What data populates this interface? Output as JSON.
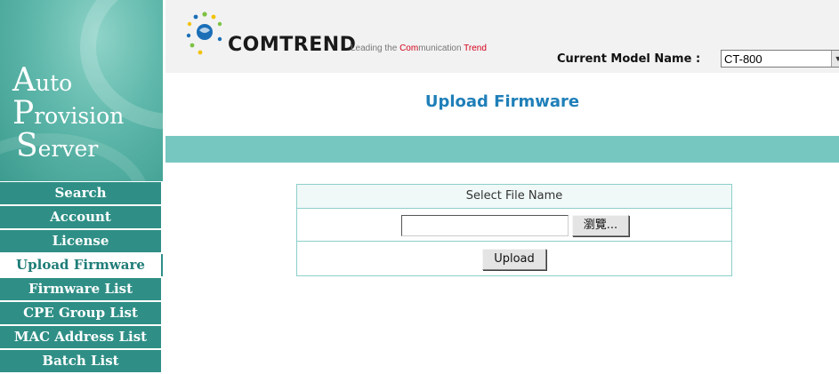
{
  "sidebar": {
    "brand": {
      "line1_cap": "A",
      "line1_rest": "uto",
      "line2_cap": "P",
      "line2_rest": "rovision",
      "line3_cap": "S",
      "line3_rest": "erver"
    },
    "items": [
      {
        "label": "Search"
      },
      {
        "label": "Account"
      },
      {
        "label": "License"
      },
      {
        "label": "Upload Firmware",
        "active": true
      },
      {
        "label": "Firmware List"
      },
      {
        "label": "CPE Group  List"
      },
      {
        "label": "MAC Address List"
      },
      {
        "label": "Batch List"
      }
    ]
  },
  "header": {
    "logo_word": "COMTREND",
    "tagline_pre": "Leading the ",
    "tagline_hl": "Com",
    "tagline_mid": "munication ",
    "tagline_hl2": "Trend",
    "model_label": "Current Model Name :",
    "model_value": "CT-800"
  },
  "page": {
    "title": "Upload Firmware"
  },
  "form": {
    "header": "Select File Name",
    "file_value": "",
    "browse_label": "瀏覽...",
    "upload_label": "Upload"
  },
  "colors": {
    "sidebar_teal": "#2f8f86",
    "bar_teal": "#76c7c0",
    "title_blue": "#1f7fb8"
  }
}
